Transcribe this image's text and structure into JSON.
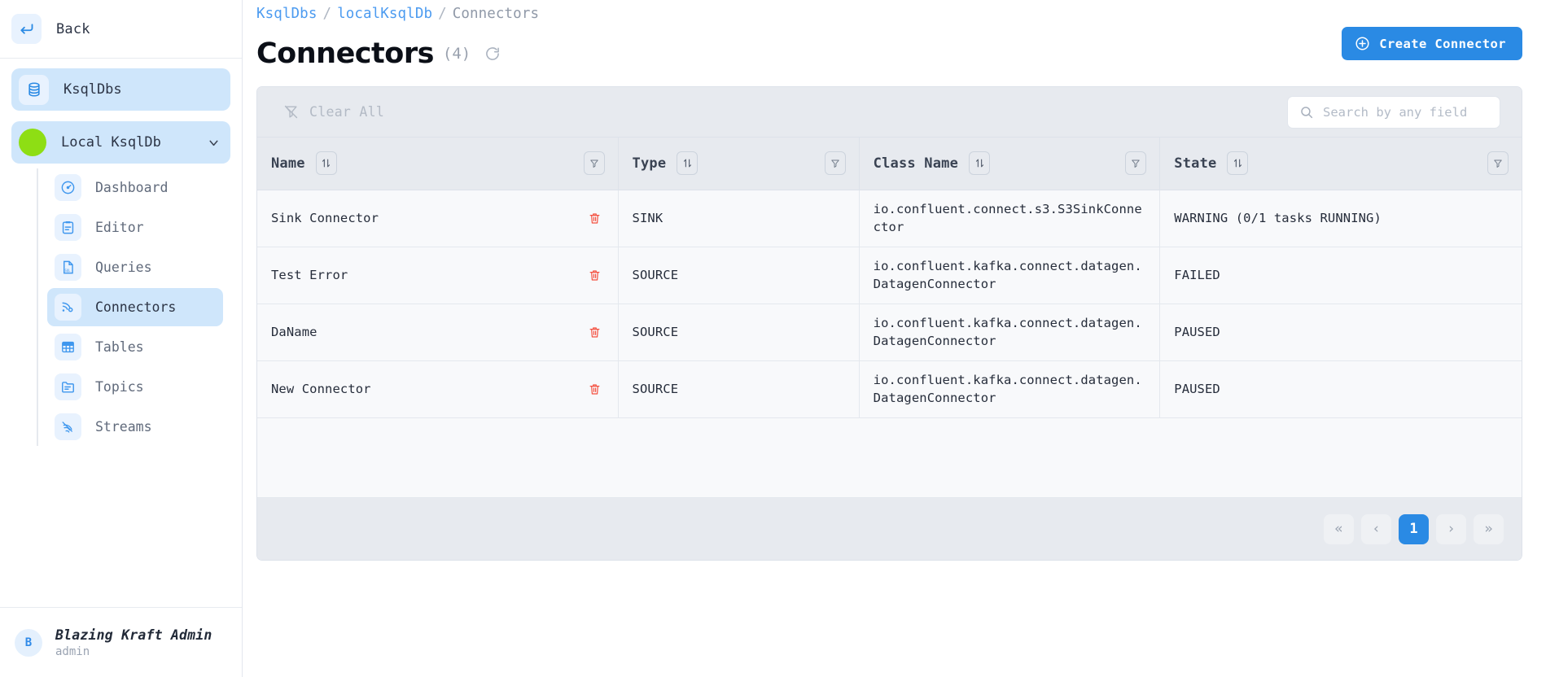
{
  "sidebar": {
    "back_label": "Back",
    "primary_item": {
      "label": "KsqlDbs",
      "icon": "database-icon"
    },
    "cluster": {
      "label": "Local KsqlDb",
      "status_color": "#8ede14",
      "chevron": "chevron-down-icon"
    },
    "items": [
      {
        "label": "Dashboard",
        "icon": "gauge-icon",
        "active": false
      },
      {
        "label": "Editor",
        "icon": "clipboard-icon",
        "active": false
      },
      {
        "label": "Queries",
        "icon": "sql-file-icon",
        "active": false
      },
      {
        "label": "Connectors",
        "icon": "connector-icon",
        "active": true
      },
      {
        "label": "Tables",
        "icon": "table-grid-icon",
        "active": false
      },
      {
        "label": "Topics",
        "icon": "folder-icon",
        "active": false
      },
      {
        "label": "Streams",
        "icon": "stream-icon",
        "active": false
      }
    ],
    "user": {
      "initial": "B",
      "name": "Blazing Kraft Admin",
      "role": "admin"
    }
  },
  "header": {
    "breadcrumb": [
      {
        "text": "KsqlDbs",
        "link": true
      },
      {
        "text": "/",
        "link": false
      },
      {
        "text": "localKsqlDb",
        "link": true
      },
      {
        "text": "/",
        "link": false
      },
      {
        "text": "Connectors",
        "link": false
      }
    ],
    "breadcrumb_0": "KsqlDbs",
    "breadcrumb_sep1": "/",
    "breadcrumb_1": "localKsqlDb",
    "breadcrumb_sep2": "/",
    "breadcrumb_2": "Connectors",
    "title": "Connectors",
    "count": "(4)",
    "refresh_icon": "refresh-icon",
    "create_button": "Create Connector",
    "accent_color": "#2a8ae4"
  },
  "toolbar": {
    "clear_all": "Clear All",
    "clear_all_icon": "filter-off-icon",
    "search_placeholder": "Search by any field",
    "search_value": "",
    "search_icon": "search-icon"
  },
  "table": {
    "columns": [
      {
        "label": "Name",
        "sort_icon": "sort-icon",
        "filter_icon": "filter-icon"
      },
      {
        "label": "Type",
        "sort_icon": "sort-icon",
        "filter_icon": "filter-icon"
      },
      {
        "label": "Class Name",
        "sort_icon": "sort-icon",
        "filter_icon": "filter-icon"
      },
      {
        "label": "State",
        "sort_icon": "sort-icon",
        "filter_icon": "filter-icon"
      }
    ],
    "rows": [
      {
        "name": "Sink Connector",
        "type": "SINK",
        "class_name": "io.confluent.connect.s3.S3SinkConnector",
        "state": "WARNING (0/1 tasks RUNNING)",
        "delete_icon": "trash-icon"
      },
      {
        "name": "Test Error",
        "type": "SOURCE",
        "class_name": "io.confluent.kafka.connect.datagen.DatagenConnector",
        "state": "FAILED",
        "delete_icon": "trash-icon"
      },
      {
        "name": "DaName",
        "type": "SOURCE",
        "class_name": "io.confluent.kafka.connect.datagen.DatagenConnector",
        "state": "PAUSED",
        "delete_icon": "trash-icon"
      },
      {
        "name": "New Connector",
        "type": "SOURCE",
        "class_name": "io.confluent.kafka.connect.datagen.DatagenConnector",
        "state": "PAUSED",
        "delete_icon": "trash-icon"
      }
    ]
  },
  "pagination": {
    "first": "«",
    "prev": "‹",
    "current": "1",
    "next": "›",
    "last": "»"
  }
}
